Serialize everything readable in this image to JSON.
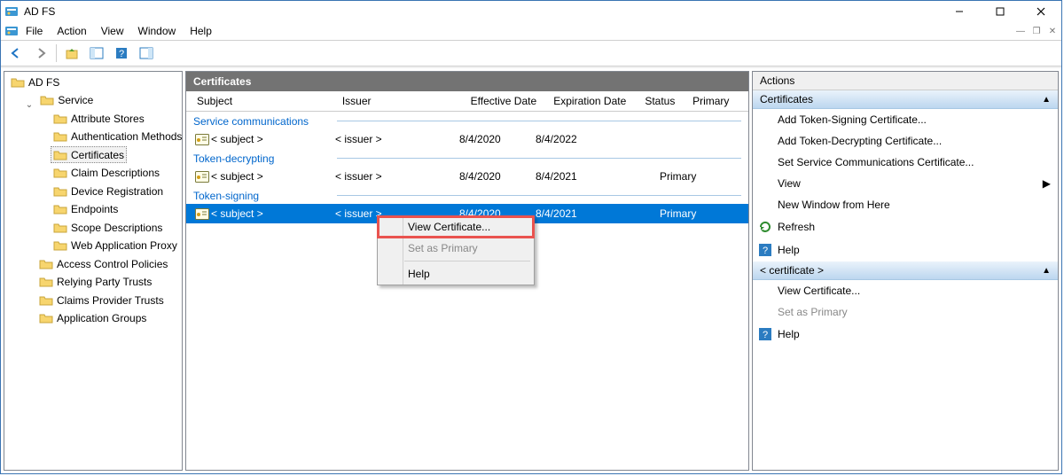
{
  "titlebar": {
    "title": "AD FS"
  },
  "menubar": {
    "items": [
      "File",
      "Action",
      "View",
      "Window",
      "Help"
    ]
  },
  "tree": {
    "root": "AD FS",
    "service": "Service",
    "service_items": [
      "Attribute Stores",
      "Authentication Methods",
      "Certificates",
      "Claim Descriptions",
      "Device Registration",
      "Endpoints",
      "Scope Descriptions",
      "Web Application Proxy"
    ],
    "top_items": [
      "Access Control Policies",
      "Relying Party Trusts",
      "Claims Provider Trusts",
      "Application Groups"
    ],
    "selected": "Certificates"
  },
  "center": {
    "header": "Certificates",
    "columns": [
      "Subject",
      "Issuer",
      "Effective Date",
      "Expiration Date",
      "Status",
      "Primary"
    ],
    "groups": [
      {
        "title": "Service communications",
        "rows": [
          {
            "subject": "< subject >",
            "issuer": "< issuer >",
            "eff": "8/4/2020",
            "exp": "8/4/2022",
            "status": "",
            "primary": "",
            "selected": false
          }
        ]
      },
      {
        "title": "Token-decrypting",
        "rows": [
          {
            "subject": "< subject >",
            "issuer": "< issuer >",
            "eff": "8/4/2020",
            "exp": "8/4/2021",
            "status": "",
            "primary": "Primary",
            "selected": false
          }
        ]
      },
      {
        "title": "Token-signing",
        "rows": [
          {
            "subject": "< subject >",
            "issuer": "< issuer >",
            "eff": "8/4/2020",
            "exp": "8/4/2021",
            "status": "",
            "primary": "Primary",
            "selected": true
          }
        ]
      }
    ]
  },
  "context_menu": {
    "items": [
      {
        "label": "View Certificate...",
        "disabled": false,
        "highlight": true
      },
      {
        "label": "Set as Primary",
        "disabled": true,
        "highlight": false
      },
      {
        "sep": true
      },
      {
        "label": "Help",
        "disabled": false,
        "highlight": false
      }
    ]
  },
  "actions": {
    "header": "Actions",
    "sections": [
      {
        "title": "Certificates",
        "items": [
          {
            "label": "Add Token-Signing Certificate...",
            "icon": "blank"
          },
          {
            "label": "Add Token-Decrypting Certificate...",
            "icon": "blank"
          },
          {
            "label": "Set Service Communications Certificate...",
            "icon": "blank"
          },
          {
            "label": "View",
            "icon": "blank",
            "arrow": true
          },
          {
            "label": "New Window from Here",
            "icon": "blank"
          },
          {
            "label": "Refresh",
            "icon": "refresh"
          },
          {
            "label": "Help",
            "icon": "help"
          }
        ]
      },
      {
        "title": "< certificate >",
        "items": [
          {
            "label": "View Certificate...",
            "icon": "blank"
          },
          {
            "label": "Set as Primary",
            "icon": "blank",
            "disabled": true
          },
          {
            "label": "Help",
            "icon": "help"
          }
        ]
      }
    ]
  }
}
